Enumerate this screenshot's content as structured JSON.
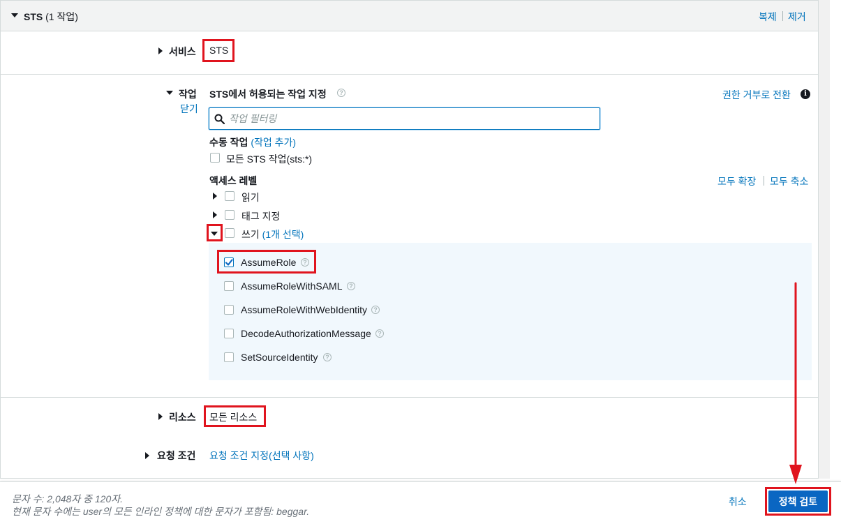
{
  "header": {
    "service_title": "STS",
    "action_count": "(1 작업)",
    "duplicate_label": "복제",
    "remove_label": "제거"
  },
  "service": {
    "label": "서비스",
    "value": "STS"
  },
  "actions": {
    "label": "작업",
    "close_label": "닫기",
    "title": "STS에서 허용되는 작업 지정",
    "switch_deny_label": "권한 거부로 전환",
    "filter_placeholder": "작업 필터링",
    "manual_label": "수동 작업",
    "manual_add_label": "(작업 추가)",
    "all_actions_label": "모든 STS 작업(sts:*)",
    "access_level_label": "액세스 레벨",
    "expand_all_label": "모두 확장",
    "collapse_all_label": "모두 축소",
    "levels": [
      {
        "label": "읽기",
        "expanded": false,
        "checked": false
      },
      {
        "label": "태그 지정",
        "expanded": false,
        "checked": false
      },
      {
        "label": "쓰기",
        "expanded": true,
        "checked": false,
        "selected_count": "(1개 선택)"
      }
    ],
    "write_actions": [
      {
        "label": "AssumeRole",
        "checked": true
      },
      {
        "label": "AssumeRoleWithSAML",
        "checked": false
      },
      {
        "label": "AssumeRoleWithWebIdentity",
        "checked": false
      },
      {
        "label": "DecodeAuthorizationMessage",
        "checked": false
      },
      {
        "label": "SetSourceIdentity",
        "checked": false
      }
    ]
  },
  "resources": {
    "label": "리소스",
    "value": "모든 리소스"
  },
  "conditions": {
    "label": "요청 조건",
    "value": "요청 조건 지정(선택 사항)"
  },
  "footer": {
    "char_count": "문자 수: 2,048자 중 120자.",
    "char_note": "현재 문자 수에는 user의 모든 인라인 정책에 대한 문자가 포함됨: beggar.",
    "cancel_label": "취소",
    "review_label": "정책 검토"
  },
  "colors": {
    "link": "#0073bb",
    "primary_button": "#0a66c2",
    "annotation_red": "#e0141e",
    "selected_area": "#f1f8fd"
  }
}
